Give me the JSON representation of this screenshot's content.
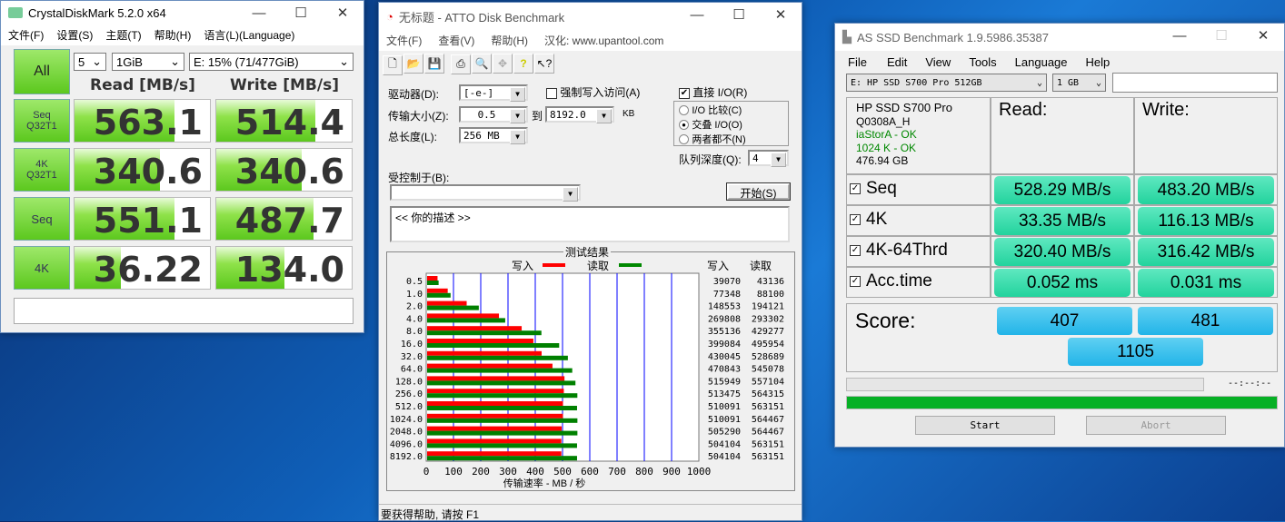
{
  "cdm": {
    "title": "CrystalDiskMark 5.2.0 x64",
    "menu": [
      "文件(F)",
      "设置(S)",
      "主题(T)",
      "帮助(H)",
      "语言(L)(Language)"
    ],
    "all_label": "All",
    "count": "5",
    "size": "1GiB",
    "drive": "E: 15% (71/477GiB)",
    "read_header": "Read [MB/s]",
    "write_header": "Write [MB/s]",
    "rows": [
      {
        "l1": "Seq",
        "l2": "Q32T1",
        "read": "563.1",
        "write": "514.4",
        "read_fill": 0.74,
        "write_fill": 0.73
      },
      {
        "l1": "4K",
        "l2": "Q32T1",
        "read": "340.6",
        "write": "340.6",
        "read_fill": 0.63,
        "write_fill": 0.63
      },
      {
        "l1": "Seq",
        "l2": "",
        "read": "551.1",
        "write": "487.7",
        "read_fill": 0.74,
        "write_fill": 0.72
      },
      {
        "l1": "4K",
        "l2": "",
        "read": "36.22",
        "write": "134.0",
        "read_fill": 0.34,
        "write_fill": 0.5
      }
    ]
  },
  "atto": {
    "title": "无标题 - ATTO Disk Benchmark",
    "menu": [
      "文件(F)",
      "查看(V)",
      "帮助(H)",
      "汉化: www.upantool.com"
    ],
    "drive_label": "驱动器(D):",
    "drive": "[-e-]",
    "force_write": "强制写入访问(A)",
    "direct_io": "直接 I/O(R)",
    "transfer_label": "传输大小(Z):",
    "transfer_from": "0.5",
    "to_label": "到",
    "transfer_to": "8192.0",
    "kb": "KB",
    "length_label": "总长度(L):",
    "length": "256 MB",
    "radio": [
      "I/O 比较(C)",
      "交叠 I/O(O)",
      "两者都不(N)"
    ],
    "radio_selected": 1,
    "queue_label": "队列深度(Q):",
    "queue": "4",
    "controlled_label": "受控制于(B):",
    "start": "开始(S)",
    "description": "<<   你的描述    >>",
    "status": "要获得帮助, 请按 F1",
    "chart_data": {
      "type": "bar",
      "title": "测试结果",
      "legend": {
        "write": "写入",
        "read": "读取"
      },
      "col_write": "写入",
      "col_read": "读取",
      "xlabel": "传输速率 - MB / 秒",
      "xlim": [
        0,
        1000
      ],
      "xticks": [
        "0",
        "100",
        "200",
        "300",
        "400",
        "500",
        "600",
        "700",
        "800",
        "900",
        "1000"
      ],
      "categories": [
        "0.5",
        "1.0",
        "2.0",
        "4.0",
        "8.0",
        "16.0",
        "32.0",
        "64.0",
        "128.0",
        "256.0",
        "512.0",
        "1024.0",
        "2048.0",
        "4096.0",
        "8192.0"
      ],
      "series": [
        {
          "name": "写入",
          "color": "#ff0000",
          "values": [
            39070,
            77348,
            148553,
            269808,
            355136,
            399084,
            430045,
            470843,
            515949,
            513475,
            510091,
            510091,
            505290,
            504104,
            504104
          ]
        },
        {
          "name": "读取",
          "color": "#008000",
          "values": [
            43136,
            88100,
            194121,
            293302,
            429277,
            495954,
            528689,
            545078,
            557104,
            564315,
            563151,
            564467,
            564467,
            563151,
            563151
          ]
        }
      ]
    }
  },
  "asssd": {
    "title": "AS SSD Benchmark 1.9.5986.35387",
    "menu": [
      "File",
      "Edit",
      "View",
      "Tools",
      "Language",
      "Help"
    ],
    "drive": "E: HP SSD S700 Pro 512GB",
    "size": "1 GB",
    "info": [
      "HP SSD S700 Pro",
      "Q0308A_H",
      "iaStorA - OK",
      "1024 K - OK",
      "476.94 GB"
    ],
    "read_header": "Read:",
    "write_header": "Write:",
    "rows": [
      {
        "name": "Seq",
        "read": "528.29 MB/s",
        "write": "483.20 MB/s"
      },
      {
        "name": "4K",
        "read": "33.35 MB/s",
        "write": "116.13 MB/s"
      },
      {
        "name": "4K-64Thrd",
        "read": "320.40 MB/s",
        "write": "316.42 MB/s"
      },
      {
        "name": "Acc.time",
        "read": "0.052 ms",
        "write": "0.031 ms"
      }
    ],
    "score_label": "Score:",
    "score_read": "407",
    "score_write": "481",
    "score_total": "1105",
    "time": "--:--:--",
    "progress": 1.0,
    "start": "Start",
    "abort": "Abort"
  }
}
